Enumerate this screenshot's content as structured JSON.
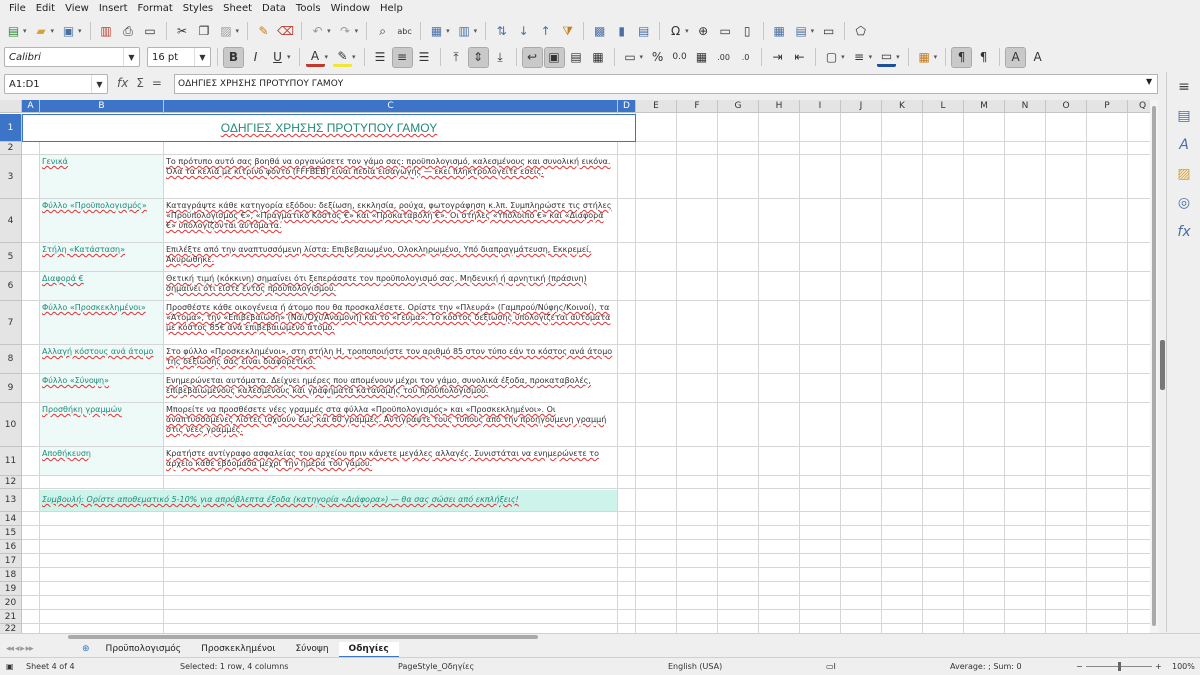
{
  "menu": [
    "File",
    "Edit",
    "View",
    "Insert",
    "Format",
    "Styles",
    "Sheet",
    "Data",
    "Tools",
    "Window",
    "Help"
  ],
  "toolbar": {
    "font_name": "Calibri",
    "font_size": "16 pt"
  },
  "formula_bar": {
    "name_box": "A1:D1",
    "content": "ΟΔΗΓΙΕΣ ΧΡΗΣΗΣ ΠΡΟΤΥΠΟΥ ΓΑΜΟΥ"
  },
  "columns": [
    "A",
    "B",
    "C",
    "D",
    "E",
    "F",
    "G",
    "H",
    "I",
    "J",
    "K",
    "L",
    "M",
    "N",
    "O",
    "P",
    "Q"
  ],
  "rows": [
    "1",
    "2",
    "3",
    "4",
    "5",
    "6",
    "7",
    "8",
    "9",
    "10",
    "11",
    "12",
    "13",
    "14",
    "15",
    "16",
    "17",
    "18",
    "19",
    "20",
    "21",
    "22"
  ],
  "sheet": {
    "title": "ΟΔΗΓΙΕΣ ΧΡΗΣΗΣ ΠΡΟΤΥΠΟΥ ΓΑΜΟΥ",
    "entries": [
      {
        "label": "Γενικά",
        "text": "Το πρότυπο αυτό σας βοηθά να οργανώσετε τον γάμο σας: προϋπολογισμό, καλεσμένους και συνολική εικόνα. Όλα τα κελιά με κίτρινο φόντο (FFFBEB) είναι πεδία εισαγωγής — εκεί πληκτρολογείτε εσείς."
      },
      {
        "label": "Φύλλο «Προϋπολογισμός»",
        "text": "Καταγράψτε κάθε κατηγορία εξόδου: δεξίωση, εκκλησία, ρούχα, φωτογράφηση κ.λπ. Συμπληρώστε τις στήλες «Προϋπολογισμός €», «Πραγματικό Κόστος €» και «Προκαταβολή €». Οι στήλες «Υπόλοιπο €» και «Διαφορά €» υπολογίζονται αυτόματα."
      },
      {
        "label": "Στήλη «Κατάσταση»",
        "text": "Επιλέξτε από την αναπτυσσόμενη λίστα: Επιβεβαιωμένο, Ολοκληρωμένο, Υπό διαπραγμάτευση, Εκκρεμεί, Ακυρώθηκε."
      },
      {
        "label": "Διαφορά €",
        "text": "Θετική τιμή (κόκκινη) σημαίνει ότι ξεπεράσατε τον προϋπολογισμό σας. Μηδενική ή αρνητική (πράσινη) σημαίνει ότι είστε εντός προϋπολογισμού."
      },
      {
        "label": "Φύλλο «Προσκεκλημένοι»",
        "text": "Προσθέστε κάθε οικογένεια ή άτομο που θα προσκαλέσετε. Ορίστε την «Πλευρά» (Γαμπρού/Νύφης/Κοινοί), τα «Άτομα», την «Επιβεβαίωση» (Ναι/Όχι/Αναμονή) και το «Γεύμα». Το κόστος δεξίωσης υπολογίζεται αυτόματα με κόστος 85€ ανά επιβεβαιωμένο άτομο."
      },
      {
        "label": "Αλλαγή κόστους ανά άτομο",
        "text": "Στο φύλλο «Προσκεκλημένοι», στη στήλη H, τροποποιήστε τον αριθμό 85 στον τύπο εάν το κόστος ανά άτομο της δεξίωσής σας είναι διαφορετικό."
      },
      {
        "label": "Φύλλο «Σύνοψη»",
        "text": "Ενημερώνεται αυτόματα. Δείχνει ημέρες που απομένουν μέχρι τον γάμο, συνολικά έξοδα, προκαταβολές, επιβεβαιωμένους καλεσμένους και γραφήματα κατανομής του προϋπολογισμού."
      },
      {
        "label": "Προσθήκη γραμμών",
        "text": "Μπορείτε να προσθέσετε νέες γραμμές στα φύλλα «Προϋπολογισμός» και «Προσκεκλημένοι». Οι αναπτυσσόμενες λίστες ισχύουν έως και 60 γραμμές. Αντιγράψτε τους τύπους από την προηγούμενη γραμμή στις νέες γραμμές."
      },
      {
        "label": "Αποθήκευση",
        "text": "Κρατήστε αντίγραφο ασφαλείας του αρχείου πριν κάνετε μεγάλες αλλαγές. Συνιστάται να ενημερώνετε το αρχείο κάθε εβδομάδα μέχρι την ημέρα του γάμου."
      }
    ],
    "tip": "Συμβουλή: Ορίστε αποθεματικό 5-10% για απρόβλεπτα έξοδα (κατηγορία «Διάφορα») — θα σας σώσει από εκπλήξεις!"
  },
  "tabs": [
    "Προϋπολογισμός",
    "Προσκεκλημένοι",
    "Σύνοψη",
    "Οδηγίες"
  ],
  "active_tab": "Οδηγίες",
  "status": {
    "sheet": "Sheet 4 of 4",
    "selection": "Selected: 1 row, 4 columns",
    "page_style": "PageStyle_Οδηγίες",
    "language": "English (USA)",
    "sum": "Average: ; Sum: 0",
    "zoom": "100%"
  },
  "colors": {
    "accent": "#3c74c8",
    "heading_green": "#1e8a79",
    "mint_bg": "#edfaf7",
    "tip_bg": "#cdf3ea"
  }
}
